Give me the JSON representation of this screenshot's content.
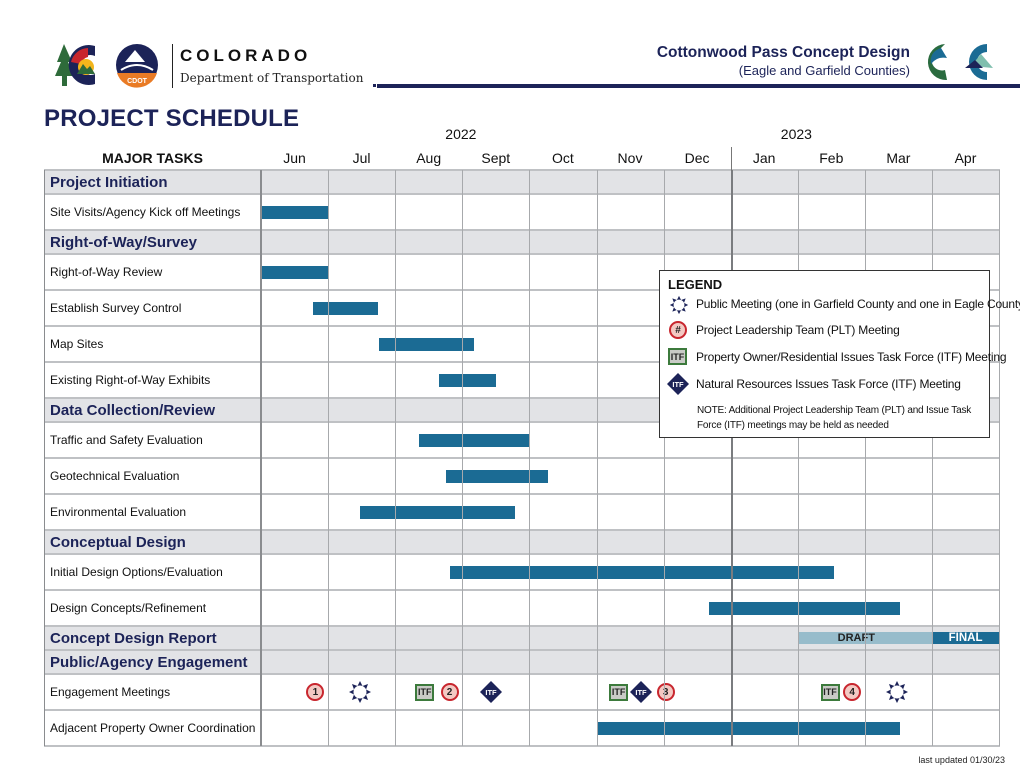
{
  "header": {
    "agency_name": "COLORADO",
    "agency_department": "Department of Transportation",
    "agency_logo_badge": "CDOT",
    "project_title": "Cottonwood Pass Concept Design",
    "project_subtitle": "(Eagle and Garfield Counties)"
  },
  "page_title": "PROJECT SCHEDULE",
  "timeline": {
    "column_header": "MAJOR TASKS",
    "years": [
      {
        "label": "2022",
        "month_index": 3
      },
      {
        "label": "2023",
        "month_index": 8
      }
    ],
    "months": [
      "Jun",
      "Jul",
      "Aug",
      "Sept",
      "Oct",
      "Nov",
      "Dec",
      "Jan",
      "Feb",
      "Mar",
      "Apr"
    ]
  },
  "rows": [
    {
      "type": "section",
      "label": "Project Initiation"
    },
    {
      "type": "task",
      "label": "Site Visits/Agency Kick off Meetings",
      "bars": [
        [
          0,
          1.0
        ]
      ]
    },
    {
      "type": "section",
      "label": "Right-of-Way/Survey"
    },
    {
      "type": "task",
      "label": "Right-of-Way Review",
      "bars": [
        [
          0,
          1.0
        ]
      ]
    },
    {
      "type": "task",
      "label": "Establish Survey Control",
      "bars": [
        [
          0.77,
          1.75
        ]
      ]
    },
    {
      "type": "task",
      "label": "Map Sites",
      "bars": [
        [
          1.76,
          3.17
        ]
      ]
    },
    {
      "type": "task",
      "label": "Existing Right-of-Way Exhibits",
      "bars": [
        [
          2.66,
          3.5
        ]
      ]
    },
    {
      "type": "section",
      "label": "Data Collection/Review"
    },
    {
      "type": "task",
      "label": "Traffic and Safety Evaluation",
      "bars": [
        [
          2.36,
          4.0
        ]
      ]
    },
    {
      "type": "task",
      "label": "Geotechnical Evaluation",
      "bars": [
        [
          2.76,
          4.28
        ]
      ]
    },
    {
      "type": "task",
      "label": "Environmental Evaluation",
      "bars": [
        [
          1.48,
          3.78
        ]
      ]
    },
    {
      "type": "section",
      "label": "Conceptual Design"
    },
    {
      "type": "task",
      "label": "Initial Design Options/Evaluation",
      "bars": [
        [
          2.82,
          8.54
        ]
      ]
    },
    {
      "type": "task",
      "label": "Design Concepts/Refinement",
      "bars": [
        [
          6.67,
          9.52
        ]
      ]
    },
    {
      "type": "report",
      "label": "Concept Design Report",
      "phases": [
        {
          "name": "DRAFT",
          "start": 8.0,
          "end": 10.0
        },
        {
          "name": "FINAL",
          "start": 10.0,
          "end": 11.0
        }
      ]
    },
    {
      "type": "section",
      "label": "Public/Agency Engagement"
    },
    {
      "type": "milestones",
      "label": "Engagement Meetings",
      "events": [
        {
          "kind": "plt",
          "label": "1",
          "month": 0.81
        },
        {
          "kind": "public",
          "label": "",
          "month": 1.47
        },
        {
          "kind": "itf-property",
          "label": "ITF",
          "month": 2.44
        },
        {
          "kind": "plt",
          "label": "2",
          "month": 2.81
        },
        {
          "kind": "itf-natural",
          "label": "ITF",
          "month": 3.43
        },
        {
          "kind": "itf-property",
          "label": "ITF",
          "month": 5.33
        },
        {
          "kind": "itf-natural",
          "label": "ITF",
          "month": 5.66
        },
        {
          "kind": "plt",
          "label": "3",
          "month": 6.03
        },
        {
          "kind": "itf-property",
          "label": "ITF",
          "month": 8.48
        },
        {
          "kind": "plt",
          "label": "4",
          "month": 8.81
        },
        {
          "kind": "public",
          "label": "",
          "month": 9.48
        }
      ]
    },
    {
      "type": "task",
      "label": "Adjacent Property Owner Coordination",
      "bars": [
        [
          5.0,
          9.52
        ]
      ]
    }
  ],
  "legend": {
    "title": "LEGEND",
    "items": [
      {
        "icon": "public-meeting",
        "label": "Public Meeting (one in Garfield County and one in Eagle County)"
      },
      {
        "icon": "plt-meeting",
        "symbol": "#",
        "label": "Project Leadership Team (PLT) Meeting"
      },
      {
        "icon": "itf-property",
        "symbol": "ITF",
        "label": "Property Owner/Residential Issues Task Force (ITF) Meeting"
      },
      {
        "icon": "itf-natural",
        "symbol": "ITF",
        "label": "Natural Resources Issues Task Force (ITF) Meeting"
      }
    ],
    "note": "NOTE: Additional Project Leadership Team (PLT) and Issue Task Force (ITF) meetings may be held as needed"
  },
  "footer": {
    "last_updated": "last updated 01/30/23"
  },
  "colors": {
    "navy": "#1c2358",
    "bar": "#1b6b94",
    "draft": "#97bccb",
    "section_bg": "#e2e3e6",
    "plt_border": "#c8262e",
    "itf_border": "#3c7a3c"
  }
}
